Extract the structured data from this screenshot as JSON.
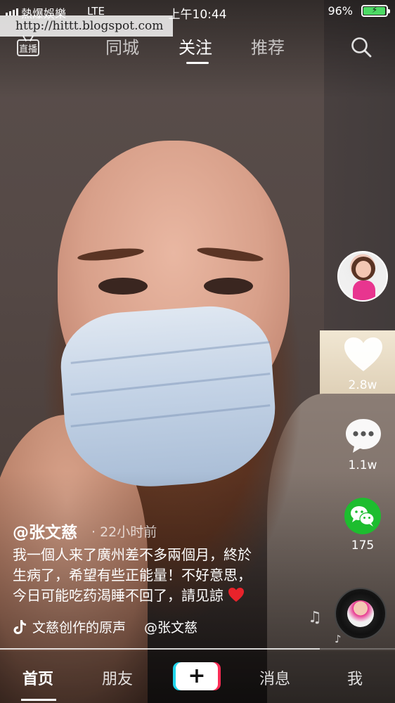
{
  "status_bar": {
    "carrier": "熱爆娛樂",
    "network": "LTE",
    "time": "上午10:44",
    "battery_percent": "96%",
    "battery_level": 0.96
  },
  "watermark": "http://hittt.blogspot.com",
  "top_nav": {
    "live_label": "直播",
    "tabs": [
      "同城",
      "关注",
      "推荐"
    ],
    "active_tab": "关注"
  },
  "right_rail": {
    "like_count": "2.8w",
    "comment_count": "1.1w",
    "share_count": "175"
  },
  "post": {
    "author": "@张文慈",
    "time_ago": "· 22小时前",
    "caption_lines": [
      "我一個人来了廣州差不多兩個月，終於",
      "生病了，希望有些正能量！不好意思，",
      "今日可能吃药渴睡不回了，請见諒"
    ],
    "music_title": "文慈创作的原声",
    "music_credit": "@张文慈"
  },
  "video_progress": 0.81,
  "bottom_nav": {
    "items": [
      "首页",
      "朋友",
      "消息",
      "我"
    ],
    "active": "首页",
    "add_label": "+"
  },
  "colors": {
    "accent_red": "#fe2c55",
    "accent_cyan": "#20d5ec",
    "wechat_green": "#1dbd2f",
    "battery_green": "#4cd964"
  }
}
